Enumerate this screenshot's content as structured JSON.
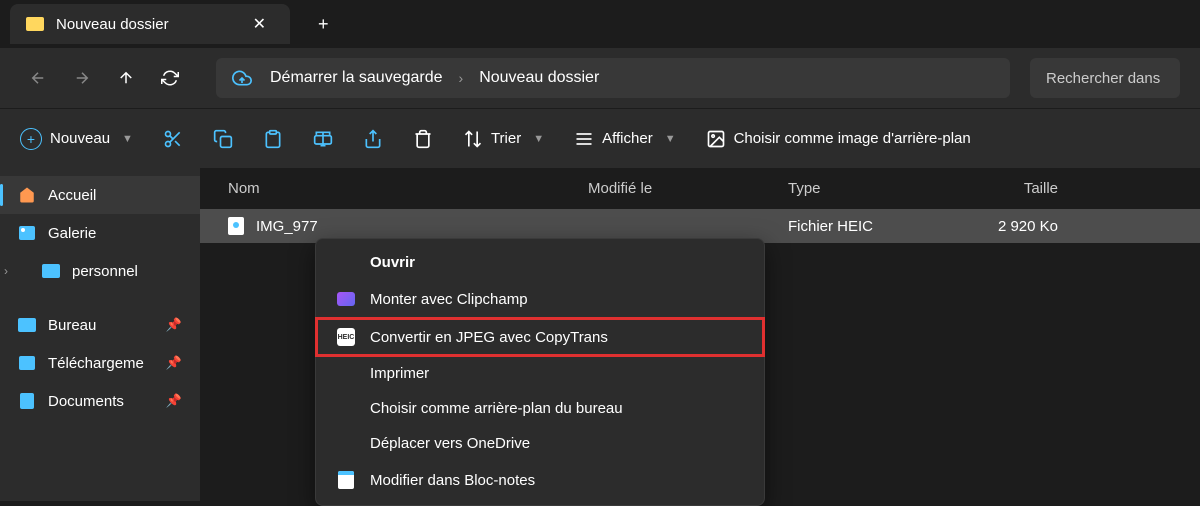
{
  "tab": {
    "title": "Nouveau dossier"
  },
  "breadcrumb": {
    "root": "Démarrer la sauvegarde",
    "current": "Nouveau dossier"
  },
  "search": {
    "placeholder": "Rechercher dans"
  },
  "toolbar": {
    "new": "Nouveau",
    "sort": "Trier",
    "view": "Afficher",
    "background": "Choisir comme image d'arrière-plan"
  },
  "sidebar": {
    "home": "Accueil",
    "gallery": "Galerie",
    "personal": "personnel",
    "desktop": "Bureau",
    "downloads": "Téléchargeme",
    "documents": "Documents"
  },
  "columns": {
    "name": "Nom",
    "modified": "Modifié le",
    "type": "Type",
    "size": "Taille"
  },
  "files": [
    {
      "name": "IMG_977",
      "modified": "",
      "type": "Fichier HEIC",
      "size": "2 920 Ko"
    }
  ],
  "context_menu": {
    "open": "Ouvrir",
    "clipchamp": "Monter avec Clipchamp",
    "copytrans": "Convertir en JPEG avec CopyTrans",
    "print": "Imprimer",
    "wallpaper": "Choisir comme arrière-plan du bureau",
    "onedrive": "Déplacer vers OneDrive",
    "notepad": "Modifier dans Bloc-notes"
  }
}
